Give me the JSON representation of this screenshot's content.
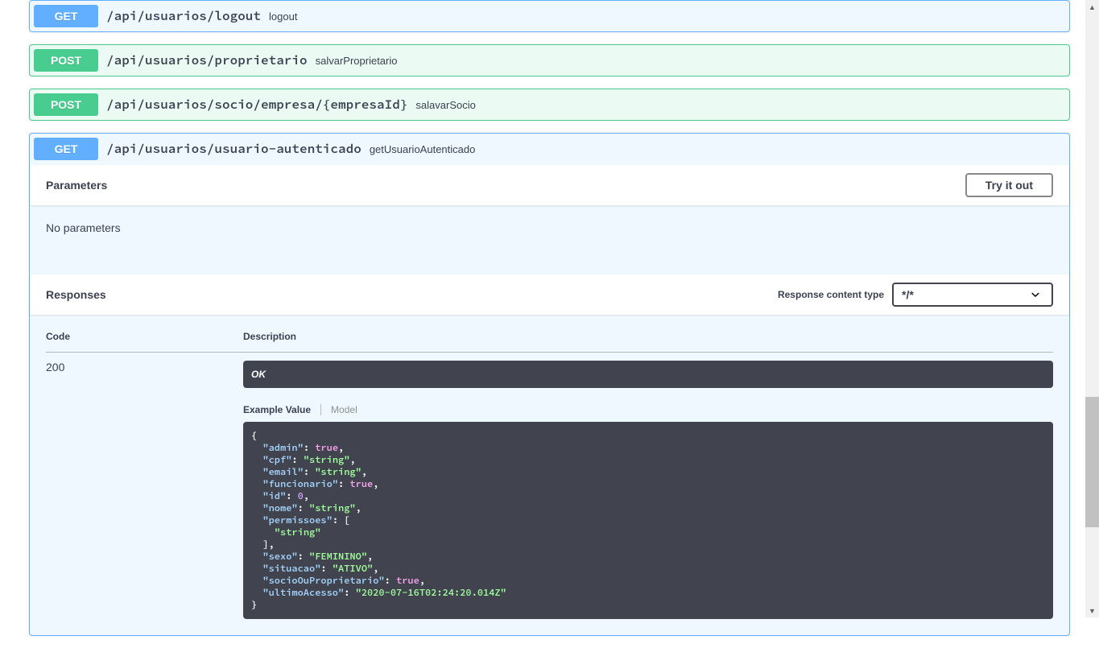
{
  "endpoints": [
    {
      "method": "GET",
      "path": "/api/usuarios/logout",
      "desc": "logout"
    },
    {
      "method": "POST",
      "path": "/api/usuarios/proprietario",
      "desc": "salvarProprietario"
    },
    {
      "method": "POST",
      "path": "/api/usuarios/socio/empresa/{empresaId}",
      "desc": "salavarSocio"
    }
  ],
  "expanded": {
    "method": "GET",
    "path": "/api/usuarios/usuario-autenticado",
    "desc": "getUsuarioAutenticado",
    "parametersHeader": "Parameters",
    "tryItOut": "Try it out",
    "noParams": "No parameters",
    "responsesHeader": "Responses",
    "contentTypeLabel": "Response content type",
    "contentTypeValue": "*/*",
    "codeHeader": "Code",
    "descHeader": "Description",
    "responseCode": "200",
    "responseText": "OK",
    "tabExample": "Example Value",
    "tabModel": "Model",
    "exampleJson": "{\n  \"admin\": true,\n  \"cpf\": \"string\",\n  \"email\": \"string\",\n  \"funcionario\": true,\n  \"id\": 0,\n  \"nome\": \"string\",\n  \"permissoes\": [\n    \"string\"\n  ],\n  \"sexo\": \"FEMININO\",\n  \"situacao\": \"ATIVO\",\n  \"socioOuProprietario\": true,\n  \"ultimoAcesso\": \"2020-07-16T02:24:20.014Z\"\n}"
  }
}
